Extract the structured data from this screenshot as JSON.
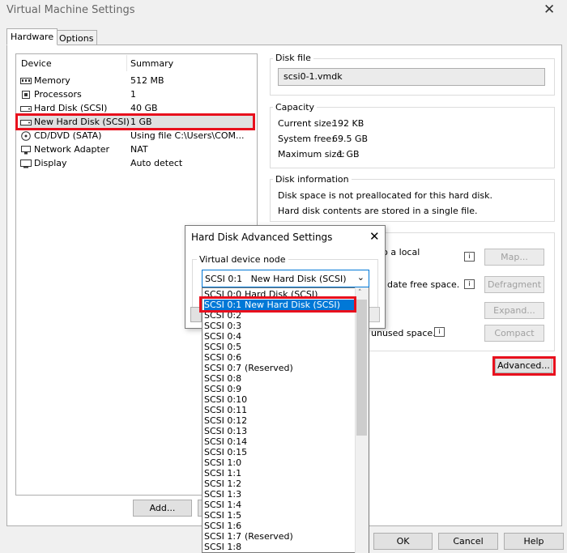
{
  "window": {
    "title": "Virtual Machine Settings"
  },
  "tabs": [
    "Hardware",
    "Options"
  ],
  "device_list": {
    "col_device": "Device",
    "col_summary": "Summary",
    "rows": [
      {
        "name": "Memory",
        "summary": "512 MB",
        "icon": "memory-icon"
      },
      {
        "name": "Processors",
        "summary": "1",
        "icon": "processor-icon"
      },
      {
        "name": "Hard Disk (SCSI)",
        "summary": "40 GB",
        "icon": "hard-disk-icon"
      },
      {
        "name": "New Hard Disk (SCSI)",
        "summary": "1 GB",
        "icon": "hard-disk-icon"
      },
      {
        "name": "CD/DVD (SATA)",
        "summary": "Using file C:\\Users\\COM...",
        "icon": "cd-dvd-icon"
      },
      {
        "name": "Network Adapter",
        "summary": "NAT",
        "icon": "network-icon"
      },
      {
        "name": "Display",
        "summary": "Auto detect",
        "icon": "display-icon"
      }
    ],
    "add_label": "Add..."
  },
  "disk_file": {
    "title": "Disk file",
    "value": "scsi0-1.vmdk"
  },
  "capacity": {
    "title": "Capacity",
    "current_label": "Current size:",
    "current": "192 KB",
    "free_label": "System free:",
    "free": "69.5 GB",
    "max_label": "Maximum size:",
    "max": "1 GB"
  },
  "disk_info": {
    "title": "Disk information",
    "line1": "Space is not preallocated for this hard disk.",
    "line1_full": "Disk space is not preallocated for this hard disk.",
    "line2": "Hard disk contents are stored in a single file."
  },
  "utilities": {
    "map_text": "k to a local",
    "defrag_text": "date free space.",
    "compact_text": "unused space.",
    "map_label": "Map...",
    "defrag_label": "Defragment",
    "expand_label": "Expand...",
    "compact_label": "Compact"
  },
  "advanced_label": "Advanced...",
  "footer": {
    "ok": "OK",
    "cancel": "Cancel",
    "help": "Help"
  },
  "dialog": {
    "title": "Hard Disk Advanced Settings",
    "group": "Virtual device node",
    "selected": "SCSI 0:1   New Hard Disk (SCSI)",
    "options": [
      [
        "SCSI 0:0",
        "Hard Disk (SCSI)"
      ],
      [
        "SCSI 0:1",
        "New Hard Disk (SCSI)"
      ],
      [
        "SCSI 0:2",
        ""
      ],
      [
        "SCSI 0:3",
        ""
      ],
      [
        "SCSI 0:4",
        ""
      ],
      [
        "SCSI 0:5",
        ""
      ],
      [
        "SCSI 0:6",
        ""
      ],
      [
        "SCSI 0:7",
        "(Reserved)"
      ],
      [
        "SCSI 0:8",
        ""
      ],
      [
        "SCSI 0:9",
        ""
      ],
      [
        "SCSI 0:10",
        ""
      ],
      [
        "SCSI 0:11",
        ""
      ],
      [
        "SCSI 0:12",
        ""
      ],
      [
        "SCSI 0:13",
        ""
      ],
      [
        "SCSI 0:14",
        ""
      ],
      [
        "SCSI 0:15",
        ""
      ],
      [
        "SCSI 1:0",
        ""
      ],
      [
        "SCSI 1:1",
        ""
      ],
      [
        "SCSI 1:2",
        ""
      ],
      [
        "SCSI 1:3",
        ""
      ],
      [
        "SCSI 1:4",
        ""
      ],
      [
        "SCSI 1:5",
        ""
      ],
      [
        "SCSI 1:6",
        ""
      ],
      [
        "SCSI 1:7",
        "(Reserved)"
      ],
      [
        "SCSI 1:8",
        ""
      ]
    ],
    "highlighted_index": 1
  },
  "colors": {
    "highlight": "#0078d7",
    "annotation": "#e8101d"
  }
}
